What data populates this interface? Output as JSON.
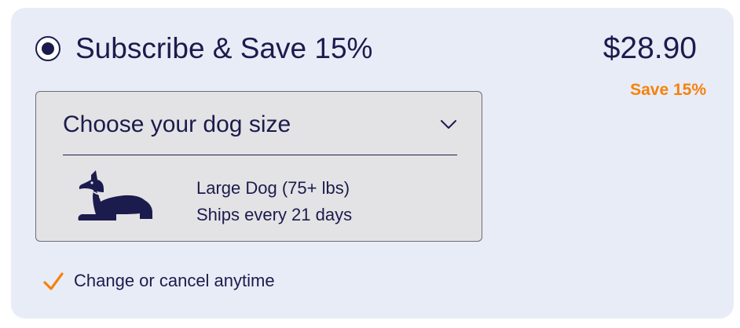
{
  "plan": {
    "selected": true,
    "title": "Subscribe & Save 15%",
    "price": "$28.90",
    "save_badge": "Save 15%"
  },
  "dog_size": {
    "dropdown_label": "Choose your dog size",
    "selected_size": "Large Dog (75+ lbs)",
    "shipping_frequency": "Ships every 21 days",
    "icons": {
      "dog": "dog-icon",
      "chevron": "chevron-down-icon"
    }
  },
  "benefits": [
    {
      "text": "Change or cancel anytime",
      "icon": "checkmark-icon"
    }
  ],
  "colors": {
    "card_background": "#e8ecf7",
    "text_primary": "#1c1b4d",
    "accent_orange": "#f5820d",
    "dropdown_background": "#e3e3e5",
    "dropdown_border": "#6d6d74"
  }
}
